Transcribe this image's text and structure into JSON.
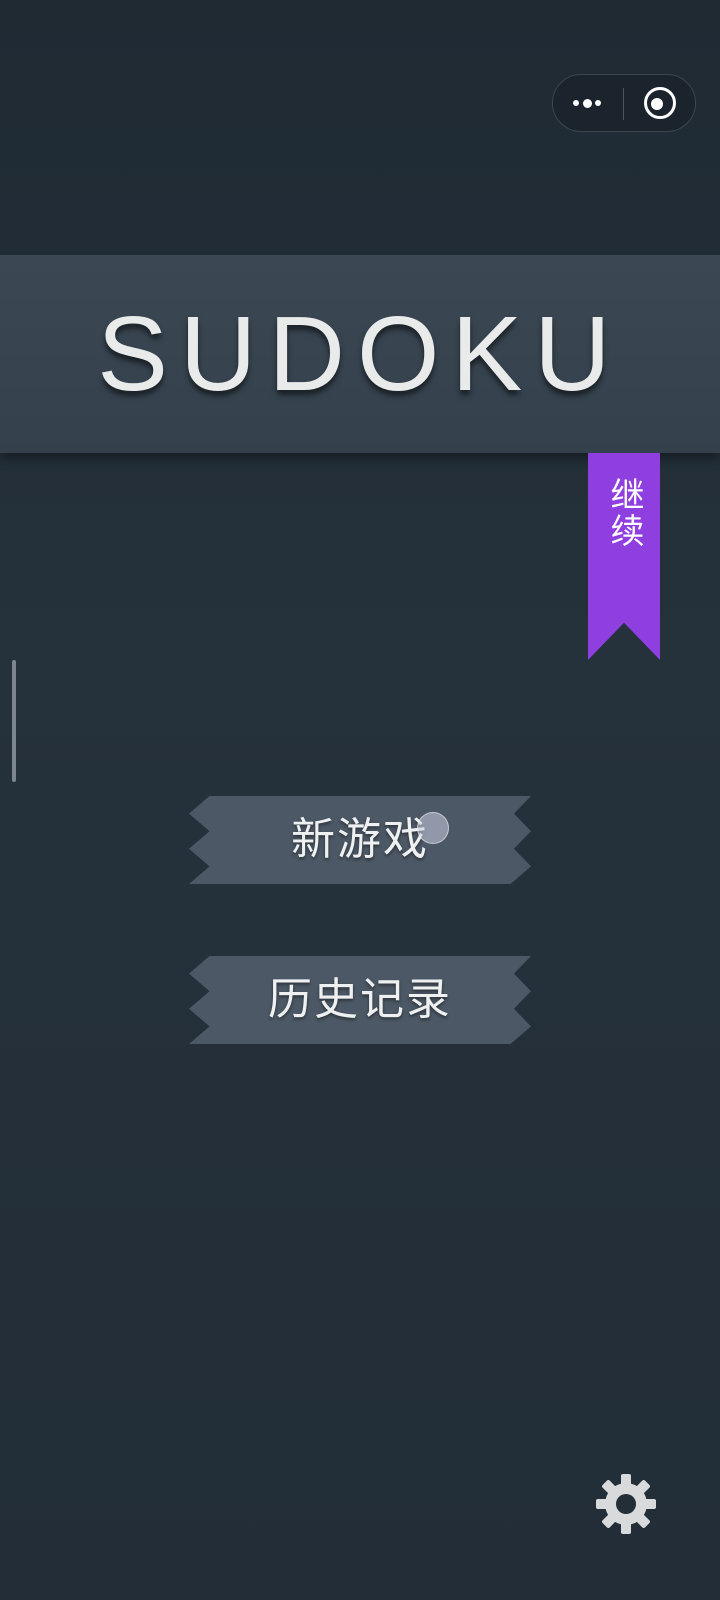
{
  "app": {
    "title": "SUDOKU"
  },
  "capsule": {
    "more_icon": "more-dots-icon",
    "close_icon": "target-circle-icon"
  },
  "menu": {
    "continue_label": "继续",
    "continue_color": "#8f3ee0",
    "new_game_label": "新游戏",
    "history_label": "历史记录",
    "button_color": "#4c5865"
  },
  "settings": {
    "icon": "gear-icon"
  },
  "colors": {
    "background": "#232e38",
    "banner": "#3b4854",
    "text": "#e9eaea"
  }
}
